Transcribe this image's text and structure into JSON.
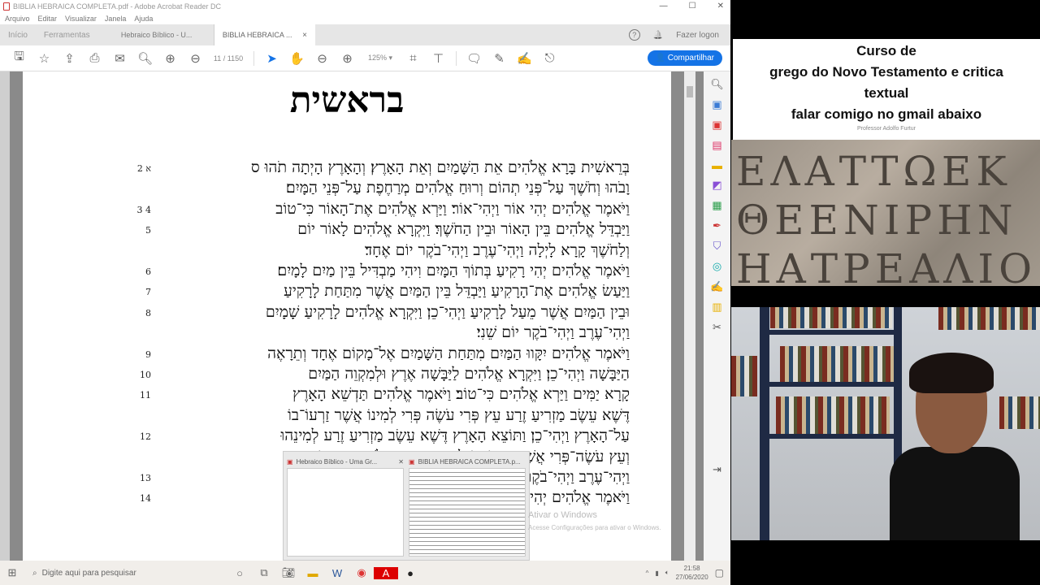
{
  "window": {
    "title": "BIBLIA HEBRAICA COMPLETA.pdf - Adobe Acrobat Reader DC",
    "controls": [
      "—",
      "☐",
      "✕"
    ]
  },
  "menu": [
    "Arquivo",
    "Editar",
    "Visualizar",
    "Janela",
    "Ajuda"
  ],
  "tabs": {
    "home": "Início",
    "tools": "Ferramentas",
    "doc1": "Hebraico Bíblico - U...",
    "doc2": "BIBLIA HEBRAICA ...",
    "close": "×"
  },
  "header_right": {
    "help": "?",
    "bell": "🔔",
    "login": "Fazer logon"
  },
  "toolbar": {
    "page_current": "11",
    "page_total": "/ 1150",
    "zoom": "125%",
    "share": "Compartilhar"
  },
  "document": {
    "title": "בראשית",
    "lines": [
      {
        "num": "א 2",
        "text": "בְּרֵאשִׁית בָּרָא אֱלֹהִים אֵת הַשָּׁמַיִם וְאֵת הָאָרֶץ׃ וְהָאָרֶץ הָיְתָה תֹהוּ ס"
      },
      {
        "num": "",
        "text": "וָבֹהוּ וְחֹשֶׁךְ עַל־פְּנֵי תְהוֹם וְרוּחַ אֱלֹהִים מְרַחֶפֶת עַל־פְּנֵי הַמָּיִם׃"
      },
      {
        "num": "3 4",
        "text": "וַיֹּאמֶר אֱלֹהִים יְהִי אוֹר וַיְהִי־אוֹר׃ וַיַּרְא אֱלֹהִים אֶת־הָאוֹר כִּי־טוֹב"
      },
      {
        "num": "5",
        "text": "וַיַּבְדֵּל אֱלֹהִים בֵּין הָאוֹר וּבֵין הַחֹשֶׁךְ׃ וַיִּקְרָא אֱלֹהִים לָאוֹר יוֹם"
      },
      {
        "num": "",
        "text": "וְלַחֹשֶׁךְ קָרָא לָיְלָה וַיְהִי־עֶרֶב וַיְהִי־בֹקֶר יוֹם אֶחָד׃"
      },
      {
        "num": "6",
        "text": "וַיֹּאמֶר אֱלֹהִים יְהִי רָקִיעַ בְּתוֹךְ הַמָּיִם וִיהִי מַבְדִּיל בֵּין מַיִם לָמָיִם׃"
      },
      {
        "num": "7",
        "text": "וַיַּעַשׂ אֱלֹהִים אֶת־הָרָקִיעַ וַיַּבְדֵּל בֵּין הַמַּיִם אֲשֶׁר מִתַּחַת לָרָקִיעַ"
      },
      {
        "num": "8",
        "text": "וּבֵין הַמַּיִם אֲשֶׁר מֵעַל לָרָקִיעַ וַיְהִי־כֵן׃ וַיִּקְרָא אֱלֹהִים לָרָקִיעַ שָׁמָיִם"
      },
      {
        "num": "",
        "text": "וַיְהִי־עֶרֶב וַיְהִי־בֹקֶר יוֹם שֵׁנִי׃"
      },
      {
        "num": "9",
        "text": "וַיֹּאמֶר אֱלֹהִים יִקָּווּ הַמַּיִם מִתַּחַת הַשָּׁמַיִם אֶל־מָקוֹם אֶחָד וְתֵרָאֶה"
      },
      {
        "num": "10",
        "text": "הַיַּבָּשָׁה וַיְהִי־כֵן׃ וַיִּקְרָא אֱלֹהִים לַיַּבָּשָׁה אֶרֶץ וּלְמִקְוֵה הַמַּיִם"
      },
      {
        "num": "11",
        "text": "קָרָא יַמִּים וַיַּרְא אֱלֹהִים כִּי־טוֹב׃ וַיֹּאמֶר אֱלֹהִים תַּדְשֵׁא הָאָרֶץ"
      },
      {
        "num": "",
        "text": "דֶּשֶׁא עֵשֶׂב מַזְרִיעַ זֶרַע עֵץ פְּרִי עֹשֶׂה פְּרִי לְמִינוֹ אֲשֶׁר זַרְעוֹ־בוֹ"
      },
      {
        "num": "12",
        "text": "עַל־הָאָרֶץ וַיְהִי־כֵן׃ וַתּוֹצֵא הָאָרֶץ דֶּשֶׁא עֵשֶׂב מַזְרִיעַ זֶרַע לְמִינֵהוּ"
      },
      {
        "num": "",
        "text": "וְעֵץ עֹשֶׂה־פְּרִי אֲשֶׁר זַרְעוֹ־בוֹ לְמִינֵהוּ וַיַּרְא אֱלֹהִים כִּי־טוֹב׃"
      },
      {
        "num": "13",
        "text": "וַיְהִי־עֶרֶב וַיְהִי־בֹקֶר יוֹם שְׁלִישִׁי׃"
      },
      {
        "num": "14",
        "text": "וַיֹּאמֶר אֱלֹהִים יְהִי מְאֹרֹת בִּרְקִיעַ הַשָּׁמַיִם לְהַבְדִּיל בֵּין הַיּוֹם"
      }
    ]
  },
  "taskbar_preview": {
    "window1": "Hebraico Bíblico - Uma Gr...",
    "window2": "BIBLIA HEBRAICA COMPLETA.p...",
    "close": "✕"
  },
  "watermark": {
    "line1": "Ativar o Windows",
    "line2": "Acesse Configurações para ativar o Windows."
  },
  "taskbar": {
    "search_placeholder": "Digite aqui para pesquisar",
    "time": "21:58",
    "date": "27/06/2020"
  },
  "overlay": {
    "line1": "Curso de",
    "line2": "grego do Novo Testamento e critica",
    "line3": "textual",
    "line4": "falar comigo no gmail abaixo",
    "credit": "Professor Adolfo Furtur"
  },
  "inscription": [
    "ΕΛΑΤΤΩΕΚ",
    "ΘΕΕΝΙΡΗΝ",
    "ΗΑΤΡΕΑΛΙΟ"
  ],
  "colors": {
    "accent": "#1473e6",
    "pdf_red": "#cc3333"
  }
}
